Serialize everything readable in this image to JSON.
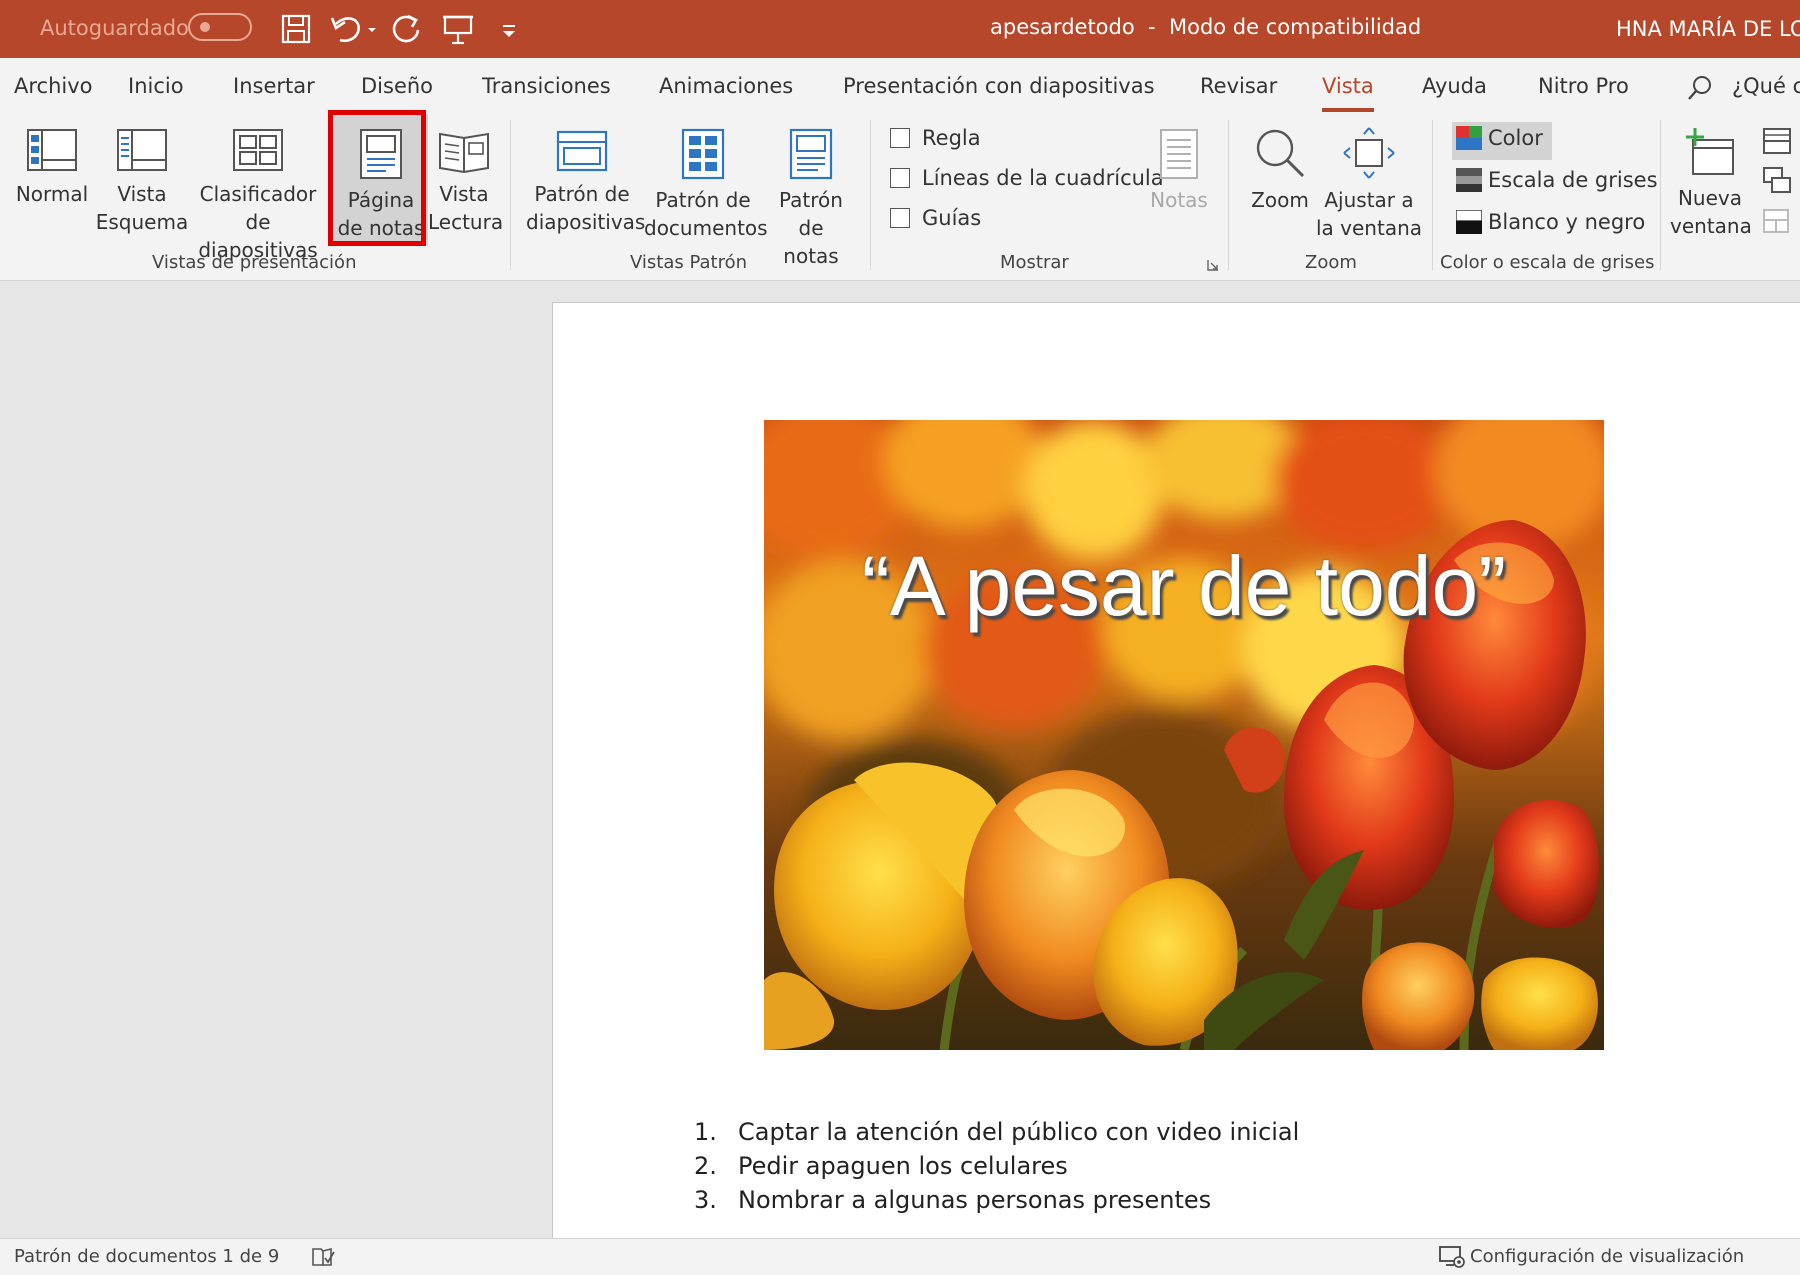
{
  "titlebar": {
    "autosave_label": "Autoguardado",
    "doc_title": "apesardetodo  -  Modo de compatibilidad",
    "user": "HNA MARÍA DE LOS"
  },
  "tabs": [
    "Archivo",
    "Inicio",
    "Insertar",
    "Diseño",
    "Transiciones",
    "Animaciones",
    "Presentación con diapositivas",
    "Revisar",
    "Vista",
    "Ayuda",
    "Nitro Pro"
  ],
  "active_tab": "Vista",
  "search_hint": "¿Qué c",
  "ribbon": {
    "vistas_presentacion": {
      "label": "Vistas de presentación",
      "normal": [
        "Normal"
      ],
      "esquema": [
        "Vista",
        "Esquema"
      ],
      "clasificador": [
        "Clasificador",
        "de diapositivas"
      ],
      "pagina_notas": [
        "Página",
        "de notas"
      ],
      "lectura": [
        "Vista",
        "Lectura"
      ]
    },
    "vistas_patron": {
      "label": "Vistas Patrón",
      "diapositivas": [
        "Patrón de",
        "diapositivas"
      ],
      "documentos": [
        "Patrón de",
        "documentos"
      ],
      "notas": [
        "Patrón",
        "de notas"
      ]
    },
    "mostrar": {
      "label": "Mostrar",
      "regla": "Regla",
      "cuadricula": "Líneas de la cuadrícula",
      "guias": "Guías",
      "notas": "Notas"
    },
    "zoom": {
      "label": "Zoom",
      "zoom": "Zoom",
      "ajustar": [
        "Ajustar a",
        "la ventana"
      ]
    },
    "color": {
      "label": "Color o escala de grises",
      "color": "Color",
      "grises": "Escala de grises",
      "bn": "Blanco y negro"
    },
    "ventana": {
      "nueva": [
        "Nueva",
        "ventana"
      ]
    }
  },
  "slide": {
    "title": "“A pesar de todo”"
  },
  "notes": [
    {
      "num": "1.",
      "text": "Captar la atención del público con video inicial"
    },
    {
      "num": "2.",
      "text": "Pedir apaguen los celulares"
    },
    {
      "num": "3.",
      "text": "Nombrar a algunas personas presentes"
    }
  ],
  "status": {
    "left": "Patrón de documentos 1 de 9",
    "right": "Configuración de visualización"
  },
  "colors": {
    "accent": "#b7472a",
    "highlight_box": "#e00000"
  }
}
